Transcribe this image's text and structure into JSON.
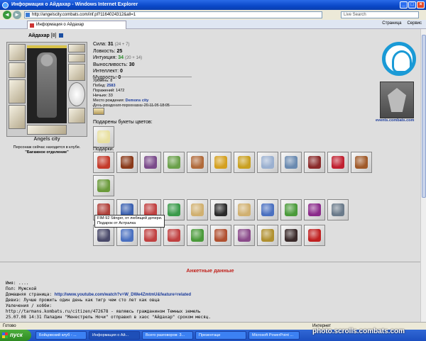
{
  "window": {
    "title": "Информация о Айдахар - Windows Internet Explorer"
  },
  "address": {
    "url": "http://angelscity.combats.com/inf.pl?1164024312&all=1",
    "search_placeholder": "Live Search"
  },
  "tab": {
    "label": "Информация о Айдахар",
    "page_label": "Страница",
    "tools_label": "Сервис"
  },
  "character": {
    "name": "Айдахар",
    "level": "[8]",
    "city": "Angels city",
    "location_line": "Персонаж сейчас находится в клубе.",
    "location_place": "\"Багажное отделение\""
  },
  "stats": [
    {
      "label": "Сила:",
      "value": "31",
      "extra": "(24 + 7)",
      "green": false
    },
    {
      "label": "Ловкость:",
      "value": "25",
      "extra": "",
      "green": false
    },
    {
      "label": "Интуиция:",
      "value": "34",
      "extra": "(20 + 14)",
      "green": true
    },
    {
      "label": "Выносливость:",
      "value": "30",
      "extra": "",
      "green": false
    },
    {
      "label": "Интеллект:",
      "value": "0",
      "extra": "",
      "green": false
    },
    {
      "label": "Мудрость:",
      "value": "0",
      "extra": "",
      "green": false
    }
  ],
  "details": [
    {
      "label": "Уровень:",
      "value": "8"
    },
    {
      "label": "Побед:",
      "value": "2583"
    },
    {
      "label": "Поражений:",
      "value": "1472"
    },
    {
      "label": "Ничьих:",
      "value": "33"
    },
    {
      "label": "Место рождения:",
      "value": "Demons city"
    },
    {
      "label": "День рождения персонажа:",
      "value": "20.11.06 18:05"
    }
  ],
  "sections": {
    "flowers": "Подарены букеты цветов:",
    "gifts": "Подарки:",
    "anket": "Анкетные данные"
  },
  "tooltip": {
    "line1": "FIM-92 Stinger, от любящей дочери.",
    "line2": "Подарок от Астралка"
  },
  "anket": {
    "name": "Имя: ....",
    "gender": "Пол: Мужской",
    "homepage_label": "Домашняя страница:",
    "homepage_url": "http://www.youtube.com/watch?v=W_DWe4ZmtmU&feature=related",
    "motto": "Девиз: Лучше прожить один день как тигр чем сто лет как овца",
    "hobby_label": "Увлечения / хобби:",
    "hobby1": "http://tarmans.kombats.ru/citizen/472678 - являюсь гражданином Темных земель",
    "hobby2": "25.07.08 14:31 Паладин \"Менестрель Ночи\" отправил в хаос \"Айдахар\" сроком месяц."
  },
  "events_link": "events.combats.com",
  "status": {
    "left": "Готово",
    "right": "Интернет"
  },
  "taskbar": {
    "start": "пуск",
    "items": [
      "Бойцовский клуб - ...",
      "Информация о Ай...",
      "Всего разговоров: 3...",
      "Презентаци",
      "Microsoft PowerPoint ..."
    ]
  },
  "watermark": "photo.scrolls.combats.com",
  "colors": {
    "accent": "#1a9ad6",
    "link": "#1a3a9a",
    "heading_red": "#c0201a",
    "green_stat": "#2a8a2a"
  },
  "gift_rows": [
    [
      "#c43a2a",
      "#8a3a1a",
      "#7a4a8a",
      "#6aa04a",
      "#b06a3a",
      "#d4a020",
      "#c9a020",
      "#9ab0d0",
      "#6a8ab0",
      "#8a2a2a",
      "#c02030",
      "#a05a2a"
    ],
    [
      "#6a9a3a"
    ],
    [
      "#b0403a",
      "#3a60b0",
      "#c04040",
      "#3a9a4a",
      "#d0b070",
      "#2a2a2a",
      "#d0b070",
      "#4a70c0",
      "#4a9a3a",
      "#8a2a8a",
      "#6a7a8a"
    ],
    [
      "#4a4a6a",
      "#4a70c0",
      "#c04040",
      "#c04040",
      "#4a9a3a",
      "#b05030",
      "#8a4a8a",
      "#b09030",
      "#3a2a2a",
      "#c02020"
    ]
  ]
}
